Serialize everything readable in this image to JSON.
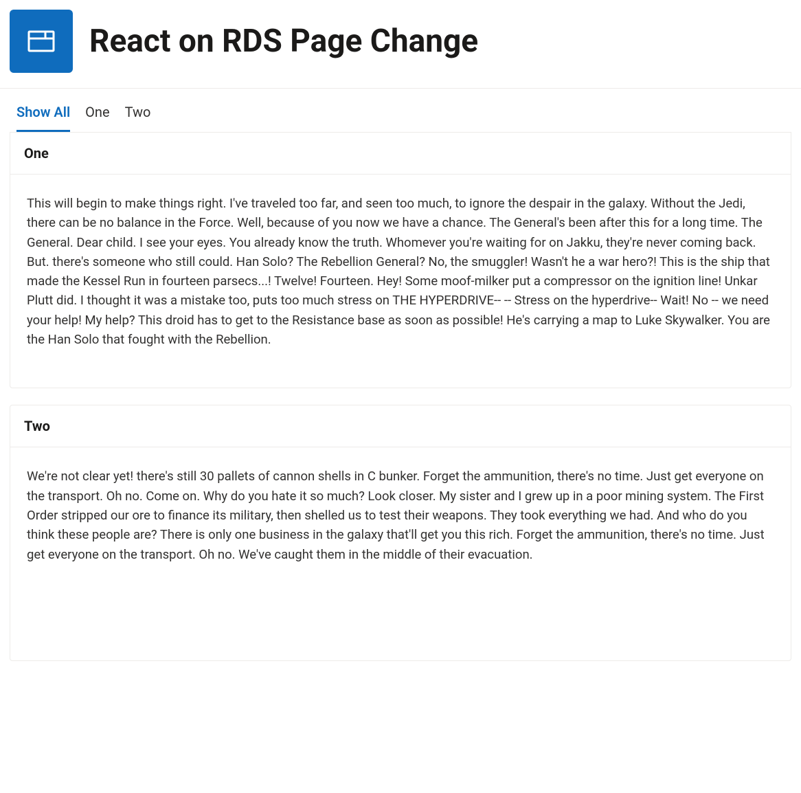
{
  "header": {
    "title": "React on RDS Page Change",
    "icon": "window-icon"
  },
  "tabs": [
    {
      "label": "Show All",
      "active": true
    },
    {
      "label": "One",
      "active": false
    },
    {
      "label": "Two",
      "active": false
    }
  ],
  "cards": [
    {
      "title": "One",
      "body": "This will begin to make things right. I've traveled too far, and seen too much, to ignore the despair in the galaxy. Without the Jedi, there can be no balance in the Force. Well, because of you now we have a chance. The General's been after this for a long time. The General. Dear child. I see your eyes. You already know the truth. Whomever you're waiting for on Jakku, they're never coming back. But. there's someone who still could. Han Solo? The Rebellion General? No, the smuggler! Wasn't he a war hero?! This is the ship that made the Kessel Run in fourteen parsecs...! Twelve! Fourteen. Hey! Some moof-milker put a compressor on the ignition line! Unkar Plutt did. I thought it was a mistake too, puts too much stress on THE HYPERDRIVE-- -- Stress on the hyperdrive-- Wait! No -- we need your help! My help? This droid has to get to the Resistance base as soon as possible! He's carrying a map to Luke Skywalker. You are the Han Solo that fought with the Rebellion."
    },
    {
      "title": "Two",
      "body": "We're not clear yet! there's still 30 pallets of cannon shells in C bunker. Forget the ammunition, there's no time. Just get everyone on the transport. Oh no. Come on. Why do you hate it so much? Look closer. My sister and I grew up in a poor mining system. The First Order stripped our ore to finance its military, then shelled us to test their weapons. They took everything we had. And who do you think these people are? There is only one business in the galaxy that'll get you this rich. Forget the ammunition, there's no time. Just get everyone on the transport. Oh no. We've caught them in the middle of their evacuation."
    }
  ]
}
